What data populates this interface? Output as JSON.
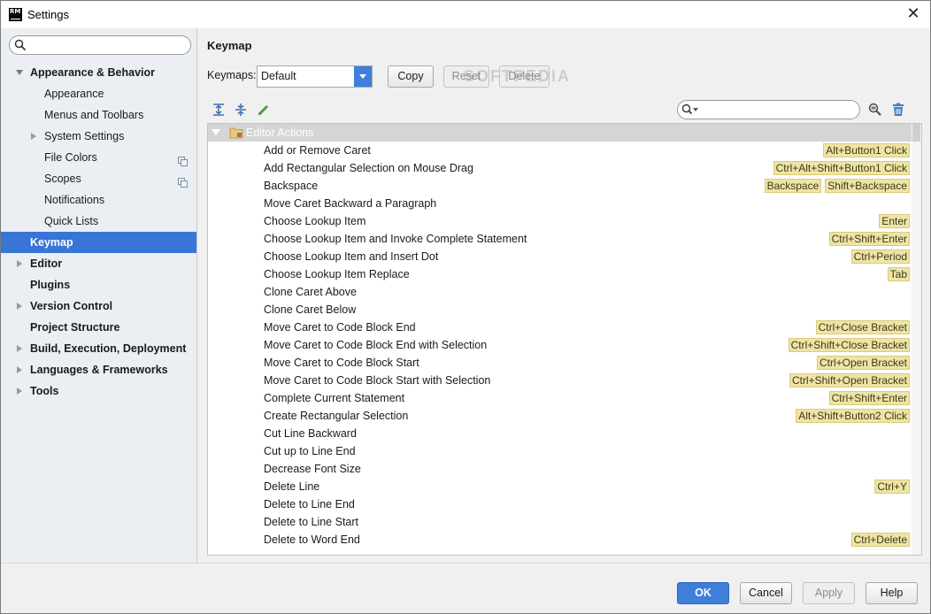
{
  "window": {
    "app_icon": "RM",
    "title": "Settings",
    "close_symbol": "✕"
  },
  "sidebar": {
    "search_placeholder": "",
    "items": [
      {
        "label": "Appearance & Behavior",
        "bold": true,
        "expanded": true,
        "level": 0
      },
      {
        "label": "Appearance",
        "level": 1
      },
      {
        "label": "Menus and Toolbars",
        "level": 1
      },
      {
        "label": "System Settings",
        "level": 1,
        "collapsed": true
      },
      {
        "label": "File Colors",
        "level": 1,
        "copy_icon": true
      },
      {
        "label": "Scopes",
        "level": 1,
        "copy_icon": true
      },
      {
        "label": "Notifications",
        "level": 1
      },
      {
        "label": "Quick Lists",
        "level": 1
      },
      {
        "label": "Keymap",
        "bold": true,
        "selected": true,
        "level": 0
      },
      {
        "label": "Editor",
        "bold": true,
        "collapsed": true,
        "level": 0
      },
      {
        "label": "Plugins",
        "bold": true,
        "level": 0
      },
      {
        "label": "Version Control",
        "bold": true,
        "collapsed": true,
        "level": 0
      },
      {
        "label": "Project Structure",
        "bold": true,
        "level": 0
      },
      {
        "label": "Build, Execution, Deployment",
        "bold": true,
        "collapsed": true,
        "level": 0
      },
      {
        "label": "Languages & Frameworks",
        "bold": true,
        "collapsed": true,
        "level": 0
      },
      {
        "label": "Tools",
        "bold": true,
        "collapsed": true,
        "level": 0
      }
    ]
  },
  "main": {
    "title": "Keymap",
    "keymaps_label": "Keymaps:",
    "keymap_selected": "Default",
    "copy_label": "Copy",
    "reset_label": "Reset",
    "delete_label": "Delete",
    "watermark": "SOFTPEDIA",
    "toolbar_icons": [
      "expand-all-icon",
      "collapse-all-icon",
      "edit-pencil-icon",
      "find-shortcut-icon",
      "trash-icon"
    ],
    "filter_placeholder": "",
    "group_label": "Editor Actions",
    "actions": [
      {
        "name": "Add or Remove Caret",
        "keys": [
          "Alt+Button1 Click"
        ]
      },
      {
        "name": "Add Rectangular Selection on Mouse Drag",
        "keys": [
          "Ctrl+Alt+Shift+Button1 Click"
        ]
      },
      {
        "name": "Backspace",
        "keys": [
          "Backspace",
          "Shift+Backspace"
        ]
      },
      {
        "name": "Move Caret Backward a Paragraph",
        "keys": []
      },
      {
        "name": "Choose Lookup Item",
        "keys": [
          "Enter"
        ]
      },
      {
        "name": "Choose Lookup Item and Invoke Complete Statement",
        "keys": [
          "Ctrl+Shift+Enter"
        ]
      },
      {
        "name": "Choose Lookup Item and Insert Dot",
        "keys": [
          "Ctrl+Period"
        ]
      },
      {
        "name": "Choose Lookup Item Replace",
        "keys": [
          "Tab"
        ]
      },
      {
        "name": "Clone Caret Above",
        "keys": []
      },
      {
        "name": "Clone Caret Below",
        "keys": []
      },
      {
        "name": "Move Caret to Code Block End",
        "keys": [
          "Ctrl+Close Bracket"
        ]
      },
      {
        "name": "Move Caret to Code Block End with Selection",
        "keys": [
          "Ctrl+Shift+Close Bracket"
        ]
      },
      {
        "name": "Move Caret to Code Block Start",
        "keys": [
          "Ctrl+Open Bracket"
        ]
      },
      {
        "name": "Move Caret to Code Block Start with Selection",
        "keys": [
          "Ctrl+Shift+Open Bracket"
        ]
      },
      {
        "name": "Complete Current Statement",
        "keys": [
          "Ctrl+Shift+Enter"
        ]
      },
      {
        "name": "Create Rectangular Selection",
        "keys": [
          "Alt+Shift+Button2 Click"
        ]
      },
      {
        "name": "Cut Line Backward",
        "keys": []
      },
      {
        "name": "Cut up to Line End",
        "keys": []
      },
      {
        "name": "Decrease Font Size",
        "keys": []
      },
      {
        "name": "Delete Line",
        "keys": [
          "Ctrl+Y"
        ]
      },
      {
        "name": "Delete to Line End",
        "keys": []
      },
      {
        "name": "Delete to Line Start",
        "keys": []
      },
      {
        "name": "Delete to Word End",
        "keys": [
          "Ctrl+Delete"
        ]
      }
    ]
  },
  "footer": {
    "ok_label": "OK",
    "cancel_label": "Cancel",
    "apply_label": "Apply",
    "help_label": "Help"
  },
  "colors": {
    "accent": "#3875d7",
    "primary_button": "#3d7fd9",
    "shortcut_bg": "#efe4a6",
    "sidebar_bg": "#ebeff3"
  }
}
